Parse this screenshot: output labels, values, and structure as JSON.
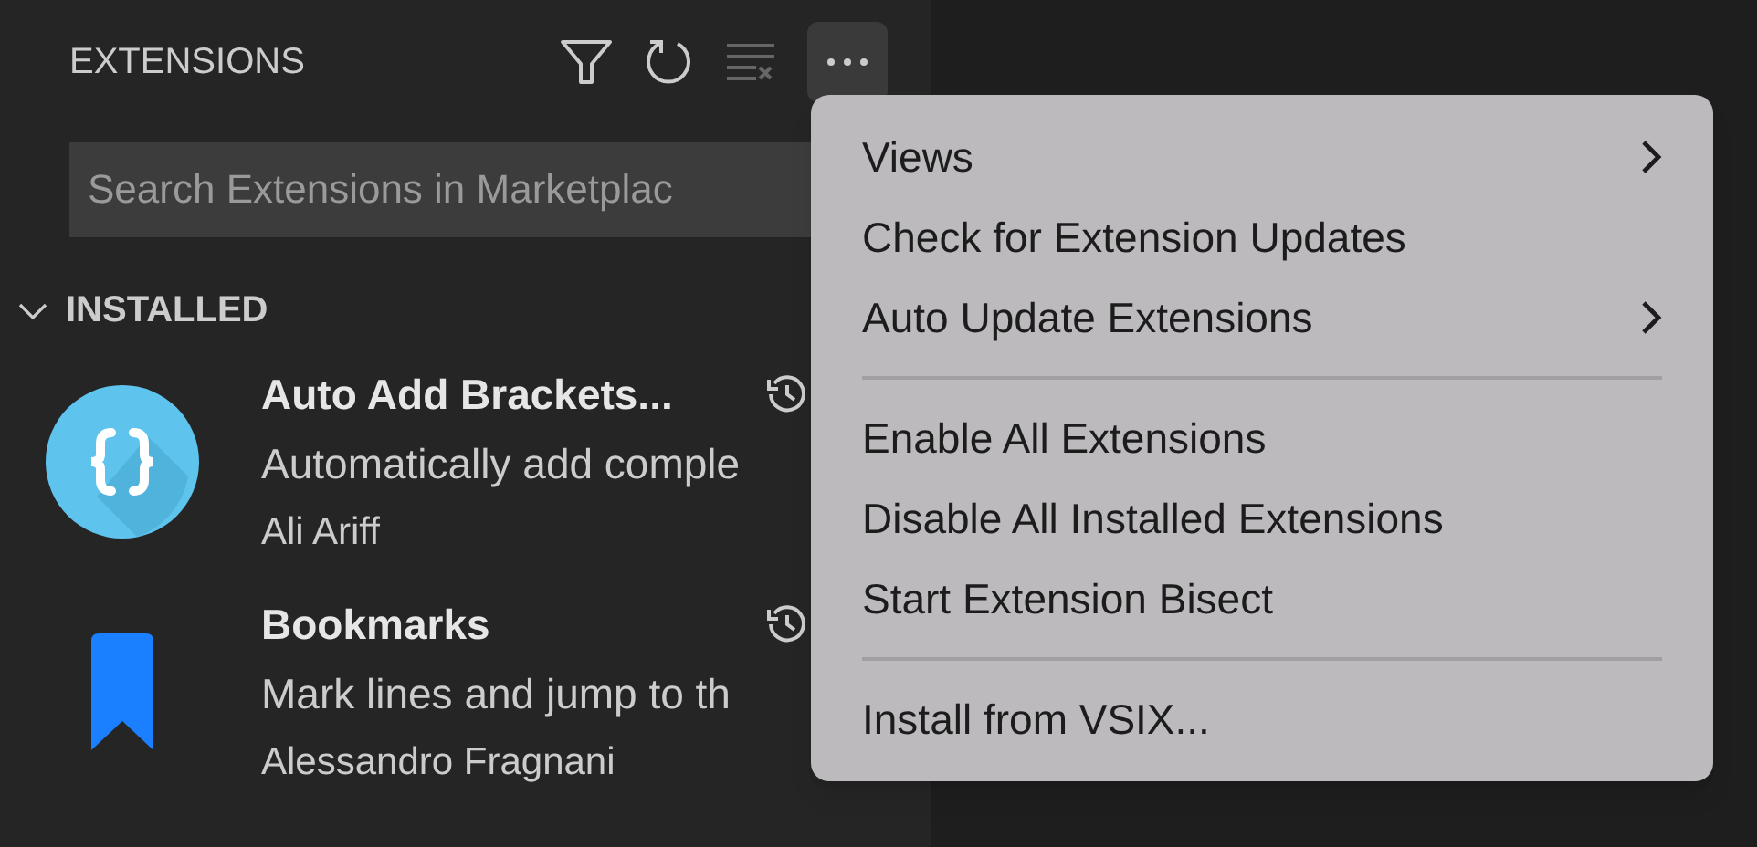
{
  "sidebar": {
    "title": "EXTENSIONS",
    "search": {
      "placeholder": "Search Extensions in Marketplac"
    },
    "section": {
      "title": "INSTALLED",
      "expanded": true
    },
    "extensions": [
      {
        "kind": "brackets",
        "name": "Auto Add Brackets...",
        "description": "Automatically add comple",
        "author": "Ali Ariff"
      },
      {
        "kind": "bookmark",
        "name": "Bookmarks",
        "description": "Mark lines and jump to th",
        "author": "Alessandro Fragnani"
      }
    ]
  },
  "menu": {
    "groups": [
      [
        {
          "label": "Views",
          "submenu": true
        },
        {
          "label": "Check for Extension Updates",
          "submenu": false
        },
        {
          "label": "Auto Update Extensions",
          "submenu": true
        }
      ],
      [
        {
          "label": "Enable All Extensions",
          "submenu": false
        },
        {
          "label": "Disable All Installed Extensions",
          "submenu": false
        },
        {
          "label": "Start Extension Bisect",
          "submenu": false
        }
      ],
      [
        {
          "label": "Install from VSIX...",
          "submenu": false
        }
      ]
    ]
  }
}
